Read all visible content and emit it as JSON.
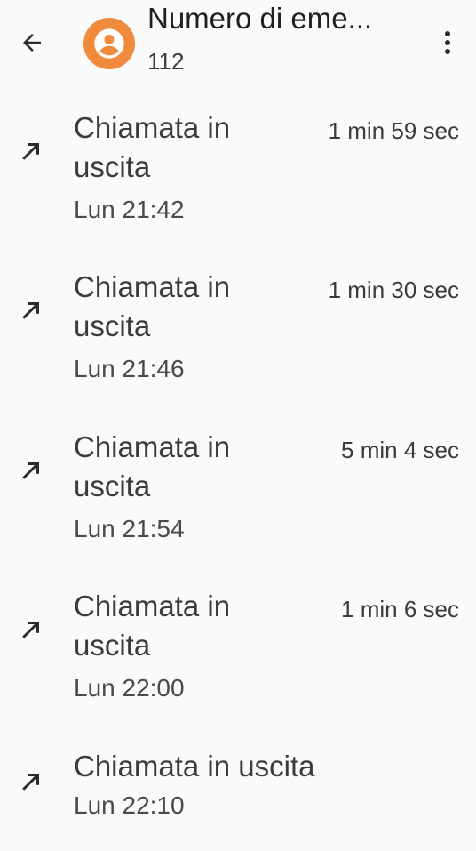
{
  "header": {
    "title": "Numero di eme...",
    "subtitle": "112",
    "avatar_color": "#f08a3c"
  },
  "calls": [
    {
      "type": "Chiamata in uscita",
      "time": "Lun 21:42",
      "duration": "1 min 59 sec",
      "icon": "outgoing-call-icon"
    },
    {
      "type": "Chiamata in uscita",
      "time": "Lun 21:46",
      "duration": "1 min 30 sec",
      "icon": "outgoing-call-icon"
    },
    {
      "type": "Chiamata in uscita",
      "time": "Lun 21:54",
      "duration": "5 min 4 sec",
      "icon": "outgoing-call-icon"
    },
    {
      "type": "Chiamata in uscita",
      "time": "Lun 22:00",
      "duration": "1 min 6 sec",
      "icon": "outgoing-call-icon"
    },
    {
      "type": "Chiamata in uscita",
      "time": "Lun 22:10",
      "duration": "",
      "icon": "outgoing-call-icon"
    }
  ]
}
